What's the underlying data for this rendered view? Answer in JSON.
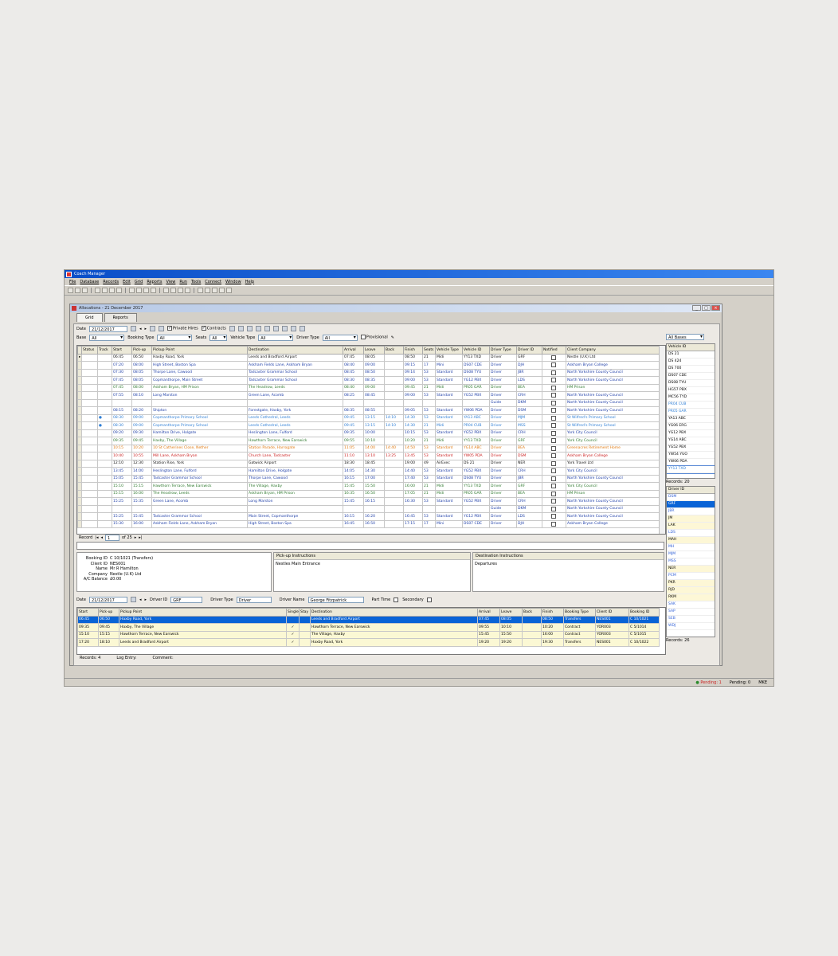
{
  "app": {
    "title": "Coach Manager",
    "menu": [
      "File",
      "Database",
      "Records",
      "Edit",
      "Grid",
      "Reports",
      "View",
      "Run",
      "Tools",
      "Connect",
      "Window",
      "Help"
    ]
  },
  "child": {
    "title": "Allocations - 21 December 2017",
    "tabs": [
      "Grid",
      "Reports"
    ]
  },
  "filters": {
    "date_label": "Date",
    "date_value": "21/12/2017",
    "private_hires": "Private Hires",
    "contracts": "Contracts",
    "base_label": "Base",
    "base_value": "All",
    "booking_type_label": "Booking Type",
    "booking_type_value": "All",
    "seats_label": "Seats",
    "seats_value": "All",
    "vehicle_type_label": "Vehicle Type",
    "vehicle_type_value": "All",
    "driver_type_label": "Driver Type",
    "driver_type_value": "All",
    "provisional": "Provisional",
    "bases_value": "All Bases"
  },
  "grid": {
    "columns": [
      "Status",
      "Track",
      "Start",
      "Pick-up",
      "Pickup Point",
      "Destination",
      "Arrival",
      "Leave",
      "Back",
      "Finish",
      "Seats",
      "Vehicle Type",
      "Vehicle ID",
      "Driver Type",
      "Driver ID",
      "Notified",
      "Client Company"
    ],
    "rows": [
      {
        "c": "c-black",
        "v": [
          "",
          "",
          "06:45",
          "06:50",
          "Haxby Road, York",
          "Leeds and Bradford Airport",
          "07:45",
          "08:05",
          "",
          "08:50",
          "21",
          "Midi",
          "YY13 TXD",
          "Driver",
          "GRF",
          "",
          "Nestle (U.K) Ltd"
        ]
      },
      {
        "c": "c-blue",
        "v": [
          "",
          "",
          "07:20",
          "08:00",
          "High Street, Boston Spa",
          "Askham Fields Lane, Askham Bryan",
          "08:40",
          "09:00",
          "",
          "09:15",
          "17",
          "Mini",
          "DS07 CDE",
          "Driver",
          "DJH",
          "",
          "Askham Bryan College"
        ]
      },
      {
        "c": "c-blue",
        "v": [
          "",
          "",
          "07:30",
          "08:05",
          "Thorpe Lane, Cawood",
          "Tadcaster Grammar School",
          "08:45",
          "08:50",
          "",
          "09:14",
          "53",
          "Standard",
          "DS08 TYU",
          "Driver",
          "JBR",
          "",
          "North Yorkshire County Council"
        ]
      },
      {
        "c": "c-blue",
        "v": [
          "",
          "",
          "07:45",
          "08:05",
          "Copmanthorpe, Main Street",
          "Tadcaster Grammar School",
          "08:30",
          "08:35",
          "",
          "09:00",
          "53",
          "Standard",
          "YG12 PBX",
          "Driver",
          "LDS",
          "",
          "North Yorkshire County Council"
        ]
      },
      {
        "c": "c-green",
        "v": [
          "",
          "",
          "07:45",
          "08:00",
          "Askham Bryan, HM Prison",
          "The Headrow, Leeds",
          "08:40",
          "09:00",
          "",
          "09:45",
          "21",
          "Midi",
          "PR05 GAR",
          "Driver",
          "BEA",
          "",
          "HM Prison"
        ]
      },
      {
        "c": "c-blue",
        "v": [
          "",
          "",
          "07:55",
          "08:10",
          "Long Marston",
          "Green Lane, Acomb",
          "08:25",
          "08:45",
          "",
          "09:00",
          "53",
          "Standard",
          "YG52 PBX",
          "Driver",
          "CRH",
          "",
          "North Yorkshire County Council"
        ]
      },
      {
        "c": "c-blue",
        "v": [
          "",
          "",
          "",
          "",
          "",
          "",
          "",
          "",
          "",
          "",
          "",
          "",
          "",
          "Guide",
          "DKM",
          "",
          "North Yorkshire County Council"
        ]
      },
      {
        "c": "c-blue",
        "v": [
          "",
          "",
          "08:15",
          "08:20",
          "Shipton",
          "Forestgate, Haxby, York",
          "08:35",
          "08:55",
          "",
          "09:05",
          "53",
          "Standard",
          "YW06 PDA",
          "Driver",
          "DSM",
          "",
          "North Yorkshire County Council"
        ]
      },
      {
        "c": "c-lblue",
        "v": [
          "",
          "●",
          "08:30",
          "09:00",
          "Copmanthorpe Primary School",
          "Leeds Cathedral, Leeds",
          "09:45",
          "13:15",
          "14:10",
          "14:30",
          "53",
          "Standard",
          "YA13 ABC",
          "Driver",
          "MJM",
          "",
          "St Wilfred's Primary School"
        ]
      },
      {
        "c": "c-lblue",
        "v": [
          "",
          "●",
          "08:30",
          "09:00",
          "Copmanthorpe Primary School",
          "Leeds Cathedral, Leeds",
          "09:45",
          "13:15",
          "14:10",
          "14:30",
          "21",
          "Midi",
          "PR04 CUB",
          "Driver",
          "MSS",
          "",
          "St Wilfred's Primary School"
        ]
      },
      {
        "c": "c-blue",
        "v": [
          "",
          "",
          "09:20",
          "09:30",
          "Hamilton Drive, Holgate",
          "Heslington Lane, Fulford",
          "09:35",
          "10:00",
          "",
          "10:15",
          "53",
          "Standard",
          "YG52 PBX",
          "Driver",
          "CRH",
          "",
          "York City Council"
        ]
      },
      {
        "c": "c-green",
        "v": [
          "",
          "",
          "09:35",
          "09:45",
          "Haxby, The Village",
          "Hawthorn Terrace, New Earswick",
          "09:55",
          "10:10",
          "",
          "10:20",
          "21",
          "Midi",
          "YY13 TXD",
          "Driver",
          "GRF",
          "",
          "York City Council"
        ]
      },
      {
        "c": "c-orange",
        "v": [
          "",
          "",
          "10:15",
          "10:20",
          "10 St Catherines Close, Nether",
          "Station Parade, Harrogate",
          "11:05",
          "14:00",
          "14:40",
          "14:50",
          "53",
          "Standard",
          "YG14 ABC",
          "Driver",
          "BEA",
          "",
          "Greenacres Retirement Home"
        ]
      },
      {
        "c": "c-red",
        "v": [
          "",
          "",
          "10:40",
          "10:55",
          "Mill Lane, Askham Bryan",
          "Church Lane, Tadcaster",
          "11:10",
          "13:10",
          "13:25",
          "13:45",
          "53",
          "Standard",
          "YW05 PDA",
          "Driver",
          "DSM",
          "",
          "Askham Bryan College"
        ]
      },
      {
        "c": "c-black",
        "v": [
          "",
          "",
          "12:10",
          "12:30",
          "Station Rise, York",
          "Gatwick Airport",
          "18:30",
          "18:45",
          "",
          "19:00",
          "49",
          "AirExec",
          "DS 21",
          "Driver",
          "NER",
          "",
          "York Travel Ltd"
        ]
      },
      {
        "c": "c-blue",
        "v": [
          "",
          "",
          "13:45",
          "14:00",
          "Heslington Lane, Fulford",
          "Hamilton Drive, Holgate",
          "14:05",
          "14:30",
          "",
          "14:40",
          "53",
          "Standard",
          "YG52 PBX",
          "Driver",
          "CRH",
          "",
          "York City Council"
        ]
      },
      {
        "c": "c-blue",
        "v": [
          "",
          "",
          "15:05",
          "15:45",
          "Tadcaster Grammar School",
          "Thorpe Lane, Cawood",
          "16:15",
          "17:00",
          "",
          "17:40",
          "53",
          "Standard",
          "DS08 TYU",
          "Driver",
          "JBR",
          "",
          "North Yorkshire County Council"
        ]
      },
      {
        "c": "c-green",
        "v": [
          "",
          "",
          "15:10",
          "15:15",
          "Hawthorn Terrace, New Earswick",
          "The Village, Haxby",
          "15:45",
          "15:50",
          "",
          "16:00",
          "21",
          "Midi",
          "YY13 TXD",
          "Driver",
          "GRF",
          "",
          "York City Council"
        ]
      },
      {
        "c": "c-green",
        "v": [
          "",
          "",
          "15:15",
          "16:00",
          "The Headrow, Leeds",
          "Askham Bryan, HM Prison",
          "16:35",
          "16:50",
          "",
          "17:05",
          "21",
          "Midi",
          "PR05 GAR",
          "Driver",
          "BEA",
          "",
          "HM Prison"
        ]
      },
      {
        "c": "c-blue",
        "v": [
          "",
          "",
          "15:25",
          "15:35",
          "Green Lane, Acomb",
          "Long Marston",
          "15:45",
          "16:15",
          "",
          "16:30",
          "53",
          "Standard",
          "YG52 PBX",
          "Driver",
          "CRH",
          "",
          "North Yorkshire County Council"
        ]
      },
      {
        "c": "c-blue",
        "v": [
          "",
          "",
          "",
          "",
          "",
          "",
          "",
          "",
          "",
          "",
          "",
          "",
          "",
          "Guide",
          "DKM",
          "",
          "North Yorkshire County Council"
        ]
      },
      {
        "c": "c-blue",
        "v": [
          "",
          "",
          "15:25",
          "15:45",
          "Tadcaster Grammar School",
          "Main Street, Copmanthorpe",
          "16:15",
          "16:20",
          "",
          "16:45",
          "53",
          "Standard",
          "YG12 PBX",
          "Driver",
          "LDS",
          "",
          "North Yorkshire County Council"
        ]
      },
      {
        "c": "c-blue",
        "v": [
          "",
          "",
          "15:30",
          "16:00",
          "Askham Fields Lane, Askham Bryan",
          "High Street, Boston Spa",
          "16:45",
          "16:50",
          "",
          "17:15",
          "17",
          "Mini",
          "DS07 CDE",
          "Driver",
          "DJH",
          "",
          "Askham Bryan College"
        ]
      }
    ],
    "record_label": "Record",
    "record_current": "1",
    "record_total": "of 25"
  },
  "booking": {
    "lines": [
      [
        "Booking ID",
        "C 10/1021 (Transfers)"
      ],
      [
        "Client ID",
        "NES001"
      ],
      [
        "Name",
        "Mr R Hamilton"
      ],
      [
        "Company",
        "Nestle (U.K) Ltd"
      ],
      [
        "A/C Balance",
        "£0.00"
      ]
    ],
    "pickup_header": "Pick-up Instructions",
    "pickup_text": "Nestles Main Entrance",
    "dest_header": "Destination Instructions",
    "dest_text": "Departures"
  },
  "driver_bar": {
    "date_label": "Date",
    "date_value": "21/12/2017",
    "driver_id_label": "Driver ID",
    "driver_id_value": "GRF",
    "driver_type_label": "Driver Type",
    "driver_type_value": "Driver",
    "driver_name_label": "Driver Name",
    "driver_name_value": "George Fitzpatrick",
    "part_time": "Part Time",
    "secondary": "Secondary"
  },
  "lower_grid": {
    "columns": [
      "Start",
      "Pick-up",
      "Pickup Point",
      "Single",
      "Stay",
      "Destination",
      "Arrival",
      "Leave",
      "Back",
      "Finish",
      "Booking Type",
      "Client ID",
      "Booking ID"
    ],
    "rows": [
      [
        "06:45",
        "06:50",
        "Haxby Road, York",
        "",
        "",
        "Leeds and Bradford Airport",
        "07:45",
        "08:05",
        "",
        "08:50",
        "Transfers",
        "NES001",
        "C 10/1021"
      ],
      [
        "09:35",
        "09:45",
        "Haxby, The Village",
        "✓",
        "",
        "Hawthorn Terrace, New Earswick",
        "09:55",
        "10:10",
        "",
        "10:20",
        "Contract",
        "YOR003",
        "C 5/1014"
      ],
      [
        "15:10",
        "15:15",
        "Hawthorn Terrace, New Earswick",
        "✓",
        "",
        "The Village, Haxby",
        "15:45",
        "15:50",
        "",
        "16:00",
        "Contract",
        "YOR003",
        "C 5/1015"
      ],
      [
        "17:20",
        "18:10",
        "Leeds and Bradford Airport",
        "✓",
        "",
        "Haxby Road, York",
        "19:20",
        "19:20",
        "",
        "19:30",
        "Transfers",
        "NES001",
        "C 10/1022"
      ]
    ],
    "records_label": "Records: 4",
    "log_entry": "Log Entry:",
    "comment": "Comment:"
  },
  "vehicles": {
    "header": "Vehicle ID",
    "items": [
      "DS 21",
      "DS 424",
      "DS 700",
      "DS07 CDE",
      "DS08 TYU",
      "HG57 PBX",
      "MC56 TYD",
      "PR04 CUB",
      "PR05 GAR",
      "YA13 ABC",
      "YG06 ERG",
      "YG12 PBX",
      "YG14 ABC",
      "YG52 PBX",
      "YW54 YUO",
      "YW06 PDA",
      "YY13 TXD"
    ],
    "records": "Records: 20"
  },
  "drivers": {
    "header": "Driver ID",
    "items": [
      "DSM",
      "GRF",
      "JBR",
      "JM",
      "LAK",
      "LDS",
      "MAH",
      "MH",
      "MJM",
      "MSS",
      "NER",
      "PCM",
      "PKR",
      "RJD",
      "RKM",
      "SAK",
      "SAP",
      "SEB",
      "WDJ"
    ],
    "selected": "GRF",
    "records": "Records: 26"
  },
  "status": {
    "pending1": "Pending: 1",
    "pending2": "Pending: 0",
    "user": "MKE"
  }
}
